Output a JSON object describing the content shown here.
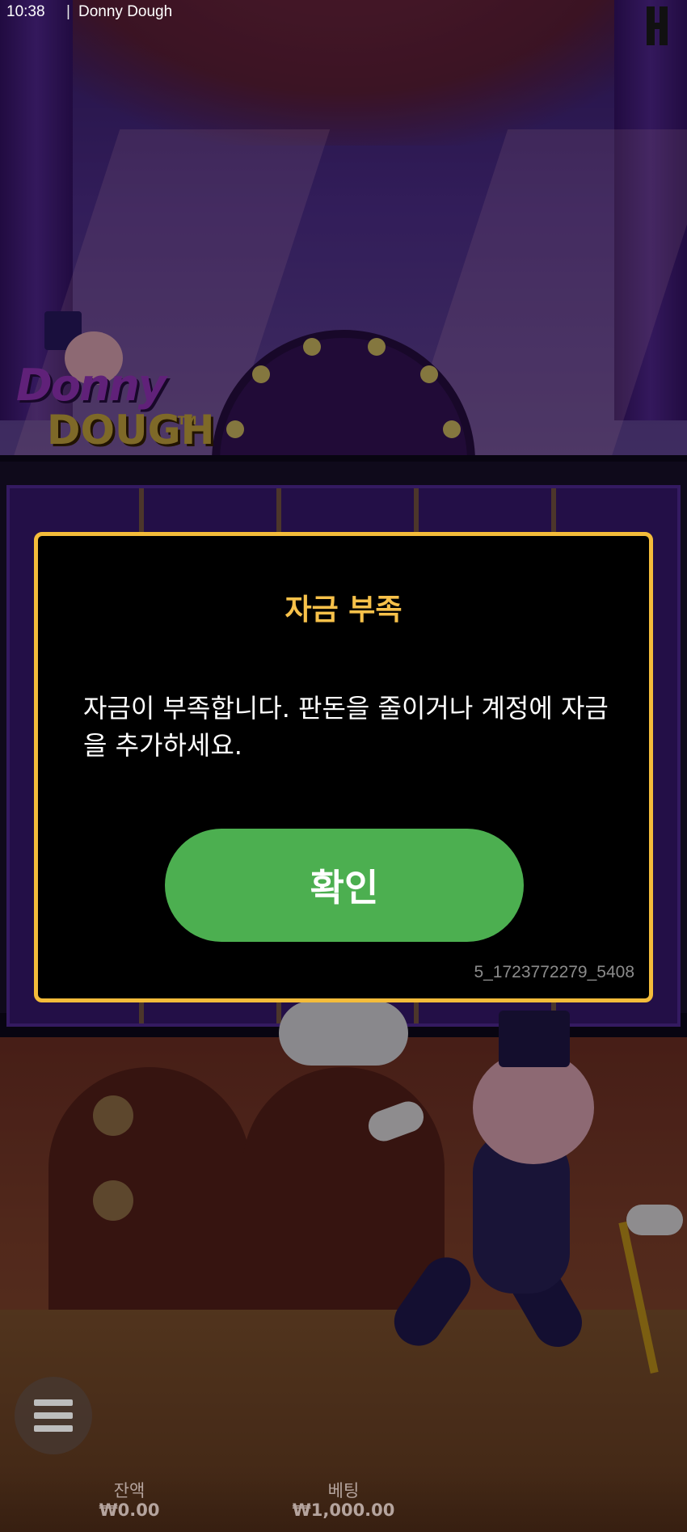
{
  "status_bar": {
    "time": "10:38",
    "separator": "|",
    "game_title": "Donny Dough"
  },
  "logo": {
    "word_1": "Donny",
    "word_2": "DOUGH",
    "trademark": "TM"
  },
  "dialog": {
    "title": "자금 부족",
    "message": "자금이 부족합니다. 판돈을 줄이거나 계정에 자금을 추가하세요.",
    "confirm_label": "확인",
    "error_code": "5_1723772279_5408"
  },
  "bottom_bar": {
    "balance_label": "잔액",
    "balance_value": "₩0.00",
    "bet_label": "베팅",
    "bet_value": "₩1,000.00"
  },
  "icons": {
    "menu": "hamburger-menu-icon",
    "brand": "provider-logo-icon"
  },
  "colors": {
    "dialog_border": "#f4bc3a",
    "dialog_title": "#f7c14a",
    "confirm_button": "#4caf50"
  }
}
